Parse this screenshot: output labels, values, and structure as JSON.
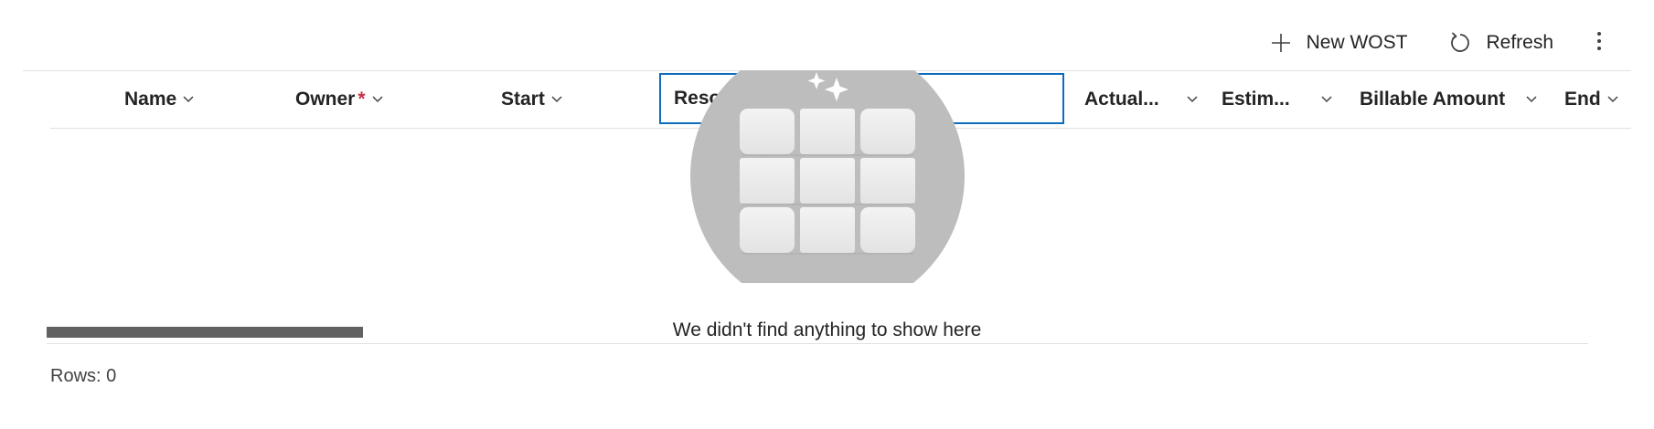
{
  "toolbar": {
    "new_label": "New WOST",
    "refresh_label": "Refresh",
    "icons": {
      "new": "plus-icon",
      "refresh": "refresh-icon",
      "more": "more-vertical-icon"
    }
  },
  "columns": {
    "name": "Name",
    "owner": "Owner",
    "owner_required": "*",
    "start": "Start",
    "resolution": "Resol",
    "actual": "Actual...",
    "estimated": "Estim...",
    "billable": "Billable Amount",
    "end": "End"
  },
  "empty_state": {
    "message": "We didn't find anything to show here",
    "illustration": "empty-grid-illustration"
  },
  "footer": {
    "rows_label": "Rows: 0"
  },
  "colors": {
    "accent": "#0f6cbd",
    "required": "#c4314b",
    "divider": "#e0e0e0",
    "text": "#242424"
  }
}
